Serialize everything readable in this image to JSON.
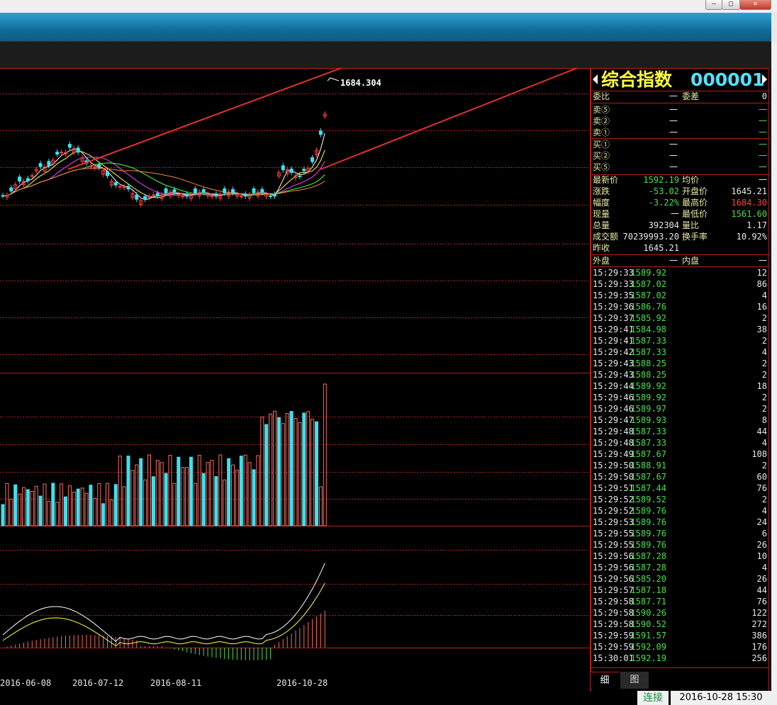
{
  "window": {
    "min_label": "—",
    "max_label": "□",
    "close_label": "✕"
  },
  "chart": {
    "price_label": "1684.304",
    "dates": [
      "2016-06-08",
      "2016-07-12",
      "2016-08-11",
      "2016-10-28"
    ]
  },
  "colors": {
    "up": "#ff4040",
    "down": "#45e045",
    "grid": "#b02020",
    "vol_up": "#ff6a5a",
    "vol_down": "#3ee0ee",
    "arrow": "#e03030"
  },
  "quote": {
    "name": "综合指数",
    "code": "000001",
    "weibi_label": "委比",
    "weibi_value": "一",
    "weicha_label": "委差",
    "weicha_value": "0",
    "asks": [
      {
        "label": "卖⑤",
        "price": "一",
        "vol": "一"
      },
      {
        "label": "卖②",
        "price": "一",
        "vol": "一"
      },
      {
        "label": "卖①",
        "price": "一",
        "vol": "一"
      }
    ],
    "bids": [
      {
        "label": "买①",
        "price": "一",
        "vol": "一"
      },
      {
        "label": "买②",
        "price": "一",
        "vol": "一"
      },
      {
        "label": "买⑤",
        "price": "一",
        "vol": "一"
      }
    ],
    "stats": [
      {
        "l1": "最新价",
        "v1": "1592.19",
        "c1": "g",
        "l2": "均价",
        "v2": "一",
        "c2": "w"
      },
      {
        "l1": "涨跌",
        "v1": "-53.02",
        "c1": "g",
        "l2": "开盘价",
        "v2": "1645.21",
        "c2": "w"
      },
      {
        "l1": "幅度",
        "v1": "-3.22%",
        "c1": "g",
        "l2": "最高价",
        "v2": "1684.30",
        "c2": "r"
      },
      {
        "l1": "现量",
        "v1": "一",
        "c1": "w",
        "l2": "最低价",
        "v2": "1561.60",
        "c2": "g"
      },
      {
        "l1": "总量",
        "v1": "392304",
        "c1": "w",
        "l2": "量比",
        "v2": "1.17",
        "c2": "w"
      },
      {
        "l1": "成交额",
        "v1": "70239993.20",
        "c1": "w",
        "l2": "换手率",
        "v2": "10.92%",
        "c2": "w"
      },
      {
        "l1": "昨收",
        "v1": "1645.21",
        "c1": "w",
        "l2": "",
        "v2": "",
        "c2": "w"
      }
    ],
    "outer_label": "外盘",
    "outer_value": "一",
    "inner_label": "内盘",
    "inner_value": "一"
  },
  "ticks": [
    {
      "time": "15:29:33",
      "price": "1589.92",
      "vol": "12"
    },
    {
      "time": "15:29:33",
      "price": "1587.02",
      "vol": "86"
    },
    {
      "time": "15:29:35",
      "price": "1587.02",
      "vol": "4"
    },
    {
      "time": "15:29:36",
      "price": "1586.76",
      "vol": "16"
    },
    {
      "time": "15:29:37",
      "price": "1585.92",
      "vol": "2"
    },
    {
      "time": "15:29:41",
      "price": "1584.98",
      "vol": "38"
    },
    {
      "time": "15:29:41",
      "price": "1587.33",
      "vol": "2"
    },
    {
      "time": "15:29:42",
      "price": "1587.33",
      "vol": "4"
    },
    {
      "time": "15:29:43",
      "price": "1588.25",
      "vol": "2"
    },
    {
      "time": "15:29:43",
      "price": "1588.25",
      "vol": "2"
    },
    {
      "time": "15:29:44",
      "price": "1589.92",
      "vol": "18"
    },
    {
      "time": "15:29:46",
      "price": "1589.92",
      "vol": "2"
    },
    {
      "time": "15:29:46",
      "price": "1589.97",
      "vol": "2"
    },
    {
      "time": "15:29:47",
      "price": "1589.93",
      "vol": "8"
    },
    {
      "time": "15:29:48",
      "price": "1587.33",
      "vol": "44"
    },
    {
      "time": "15:29:48",
      "price": "1587.33",
      "vol": "4"
    },
    {
      "time": "15:29:49",
      "price": "1587.67",
      "vol": "108"
    },
    {
      "time": "15:29:50",
      "price": "1588.91",
      "vol": "2"
    },
    {
      "time": "15:29:50",
      "price": "1587.67",
      "vol": "60"
    },
    {
      "time": "15:29:51",
      "price": "1587.44",
      "vol": "76"
    },
    {
      "time": "15:29:52",
      "price": "1589.52",
      "vol": "2"
    },
    {
      "time": "15:29:52",
      "price": "1589.76",
      "vol": "4"
    },
    {
      "time": "15:29:53",
      "price": "1589.76",
      "vol": "24"
    },
    {
      "time": "15:29:55",
      "price": "1589.76",
      "vol": "6"
    },
    {
      "time": "15:29:55",
      "price": "1589.76",
      "vol": "26"
    },
    {
      "time": "15:29:56",
      "price": "1587.28",
      "vol": "10"
    },
    {
      "time": "15:29:56",
      "price": "1587.28",
      "vol": "4"
    },
    {
      "time": "15:29:56",
      "price": "1585.20",
      "vol": "26"
    },
    {
      "time": "15:29:57",
      "price": "1587.18",
      "vol": "44"
    },
    {
      "time": "15:29:58",
      "price": "1587.71",
      "vol": "76"
    },
    {
      "time": "15:29:58",
      "price": "1590.26",
      "vol": "122"
    },
    {
      "time": "15:29:58",
      "price": "1590.52",
      "vol": "272"
    },
    {
      "time": "15:29:59",
      "price": "1591.57",
      "vol": "386"
    },
    {
      "time": "15:29:59",
      "price": "1592.09",
      "vol": "176"
    },
    {
      "time": "15:30:01",
      "price": "1592.19",
      "vol": "256"
    }
  ],
  "tabs": [
    {
      "label": "细"
    },
    {
      "label": "图"
    }
  ],
  "status": {
    "connect": "连接",
    "datetime": "2016-10-28  15:30"
  }
}
